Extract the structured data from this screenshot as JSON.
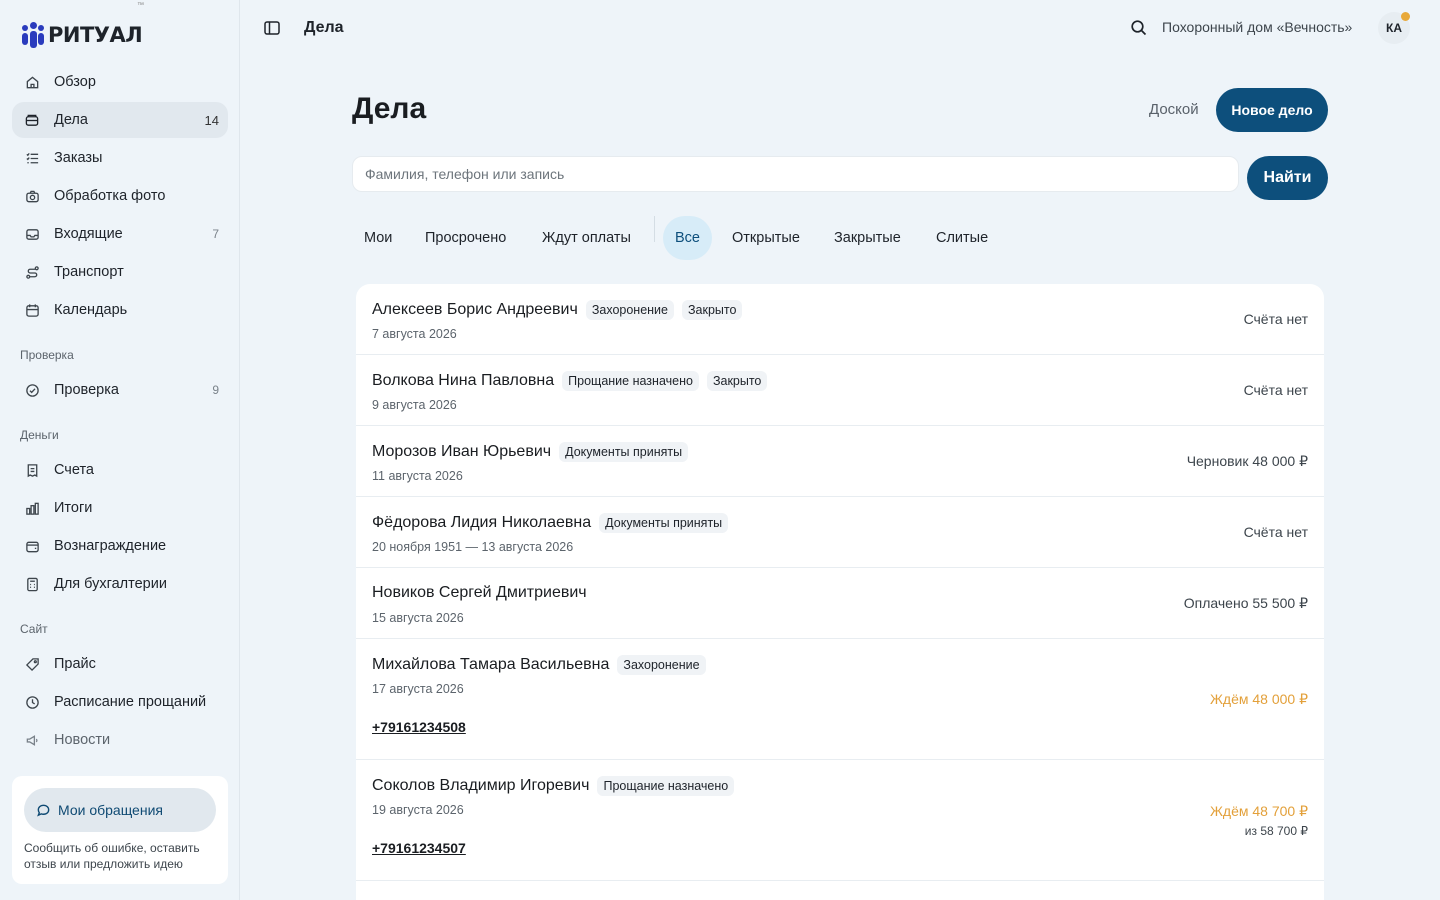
{
  "app": {
    "logo_text": "РИТУАЛ",
    "logo_tm": "™"
  },
  "sidebar": {
    "items": [
      {
        "label": "Обзор",
        "icon": "home-icon"
      },
      {
        "label": "Дела",
        "icon": "folder-icon",
        "count": "14"
      },
      {
        "label": "Заказы",
        "icon": "list-icon"
      },
      {
        "label": "Обработка фото",
        "icon": "camera-icon"
      },
      {
        "label": "Входящие",
        "icon": "inbox-icon",
        "count": "7"
      },
      {
        "label": "Транспорт",
        "icon": "route-icon"
      },
      {
        "label": "Календарь",
        "icon": "calendar-icon"
      }
    ],
    "sections": {
      "check": {
        "label": "Проверка",
        "items": [
          {
            "label": "Проверка",
            "icon": "check-circle-icon",
            "count": "9"
          }
        ]
      },
      "money": {
        "label": "Деньги",
        "items": [
          {
            "label": "Счета",
            "icon": "receipt-icon"
          },
          {
            "label": "Итоги",
            "icon": "bar-chart-icon"
          },
          {
            "label": "Вознаграждение",
            "icon": "wallet-icon"
          },
          {
            "label": "Для бухгалтерии",
            "icon": "calculator-icon"
          }
        ]
      },
      "site": {
        "label": "Сайт",
        "items": [
          {
            "label": "Прайс",
            "icon": "tag-icon"
          },
          {
            "label": "Расписание прощаний",
            "icon": "clock-icon"
          },
          {
            "label": "Новости",
            "icon": "megaphone-icon"
          }
        ]
      }
    },
    "feedback": {
      "button_label": "Мои обращения",
      "text": "Сообщить об ошибке, оставить отзыв или предложить идею"
    }
  },
  "topbar": {
    "title": "Дела",
    "org": "Похоронный дом «Вечность»",
    "avatar": "КА"
  },
  "main": {
    "title": "Дела",
    "board_label": "Доской",
    "new_case_label": "Новое дело",
    "search": {
      "placeholder": "Фамилия, телефон или запись",
      "value": ""
    },
    "find_label": "Найти",
    "tabs": [
      "Мои",
      "Просрочено",
      "Ждут оплаты",
      "Все",
      "Открытые",
      "Закрытые",
      "Слитые"
    ],
    "active_tab": "Все",
    "cases": [
      {
        "name": "Алексеев Борис Андреевич",
        "badges": [
          "Захоронение",
          "Закрыто"
        ],
        "date": "7 августа 2026",
        "status": "Счёта нет"
      },
      {
        "name": "Волкова Нина Павловна",
        "badges": [
          "Прощание назначено",
          "Закрыто"
        ],
        "date": "9 августа 2026",
        "status": "Счёта нет"
      },
      {
        "name": "Морозов Иван Юрьевич",
        "badges": [
          "Документы приняты"
        ],
        "date": "11 августа 2026",
        "status": "Черновик 48 000 ₽"
      },
      {
        "name": "Фёдорова Лидия Николаевна",
        "badges": [
          "Документы приняты"
        ],
        "date": "20 ноября 1951 — 13 августа 2026",
        "status": "Счёта нет"
      },
      {
        "name": "Новиков Сергей Дмитриевич",
        "badges": [],
        "date": "15 августа 2026",
        "status": "Оплачено 55 500 ₽"
      },
      {
        "name": "Михайлова Тамара Васильевна",
        "badges": [
          "Захоронение"
        ],
        "date": "17 августа 2026",
        "phone": "+79161234508",
        "status": "Ждём 48 000 ₽"
      },
      {
        "name": "Соколов Владимир Игоревич",
        "badges": [
          "Прощание назначено"
        ],
        "date": "19 августа 2026",
        "phone": "+79161234507",
        "status": "Ждём 48 700 ₽",
        "status_sub": "из 58 700 ₽"
      }
    ]
  },
  "colors": {
    "accent": "#0d4f7c",
    "warning": "#e3a03a",
    "badge_bg": "#f0f3f6",
    "active_tab_bg": "#d7ecf8",
    "notification_dot": "#e8a93a"
  }
}
